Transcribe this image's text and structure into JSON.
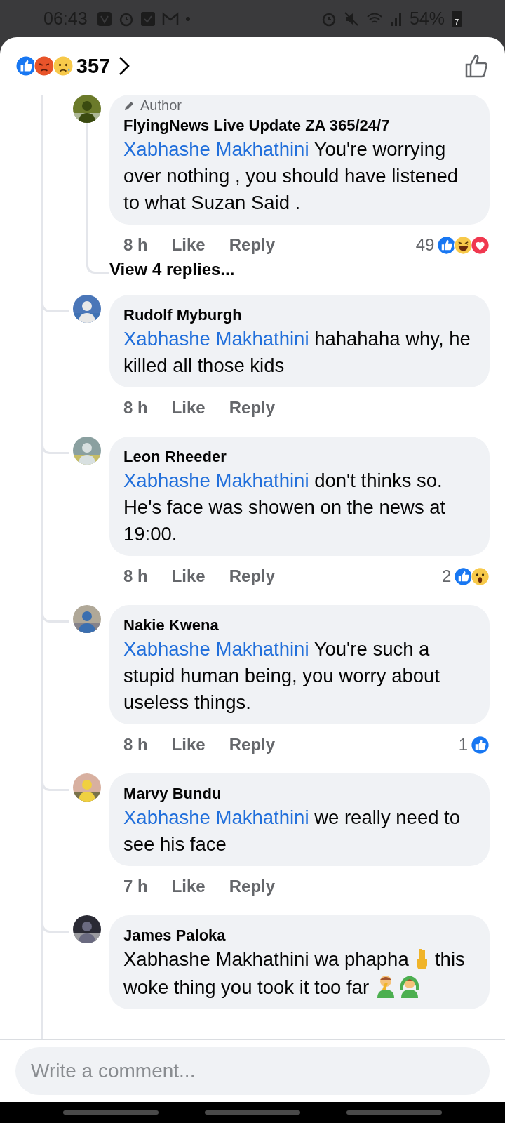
{
  "status_bar": {
    "time": "06:43",
    "battery": "54%",
    "battery_badge": "7"
  },
  "header": {
    "reactions": [
      {
        "kind": "like"
      },
      {
        "kind": "angry"
      },
      {
        "kind": "sad"
      }
    ],
    "count": "357"
  },
  "author_comment": {
    "badge": "Author",
    "name": "FlyingNews Live Update ZA 365/24/7",
    "body": [
      {
        "kind": "mention",
        "text": "Xabhashe Makhathini"
      },
      {
        "kind": "text",
        "text": " You're worrying over nothing , you should have listened to what Suzan Said ."
      }
    ],
    "time": "8 h",
    "like": "Like",
    "reply": "Reply",
    "reaction_count": "49",
    "reactions": [
      {
        "kind": "like"
      },
      {
        "kind": "haha"
      },
      {
        "kind": "love"
      }
    ],
    "view_replies": "View 4 replies..."
  },
  "comments": [
    {
      "name": "Rudolf Myburgh",
      "body": [
        {
          "kind": "mention",
          "text": "Xabhashe Makhathini"
        },
        {
          "kind": "text",
          "text": " hahahaha why, he killed all those kids"
        }
      ],
      "time": "8 h",
      "like": "Like",
      "reply": "Reply"
    },
    {
      "name": "Leon Rheeder",
      "body": [
        {
          "kind": "mention",
          "text": "Xabhashe Makhathini"
        },
        {
          "kind": "text",
          "text": " don't thinks so. He's face was showen on the news at 19:00."
        }
      ],
      "time": "8 h",
      "like": "Like",
      "reply": "Reply",
      "reaction_count": "2",
      "reactions": [
        {
          "kind": "like"
        },
        {
          "kind": "wow"
        }
      ]
    },
    {
      "name": "Nakie Kwena",
      "body": [
        {
          "kind": "mention",
          "text": "Xabhashe Makhathini"
        },
        {
          "kind": "text",
          "text": " You're such a stupid human being, you worry about useless things."
        }
      ],
      "time": "8 h",
      "like": "Like",
      "reply": "Reply",
      "reaction_count": "1",
      "reactions": [
        {
          "kind": "like"
        }
      ]
    },
    {
      "name": "Marvy Bundu",
      "body": [
        {
          "kind": "mention",
          "text": "Xabhashe Makhathini"
        },
        {
          "kind": "text",
          "text": " we really need to see his face"
        }
      ],
      "time": "7 h",
      "like": "Like",
      "reply": "Reply"
    },
    {
      "name": "James Paloka",
      "body": [
        {
          "kind": "text",
          "text": "Xabhashe Makhathini wa phapha "
        },
        {
          "kind": "fingers"
        },
        {
          "kind": "text",
          "text": " this woke thing you took it too far "
        },
        {
          "kind": "facepalm"
        },
        {
          "kind": "gesture"
        }
      ]
    }
  ],
  "composer": {
    "placeholder": "Write a comment..."
  }
}
